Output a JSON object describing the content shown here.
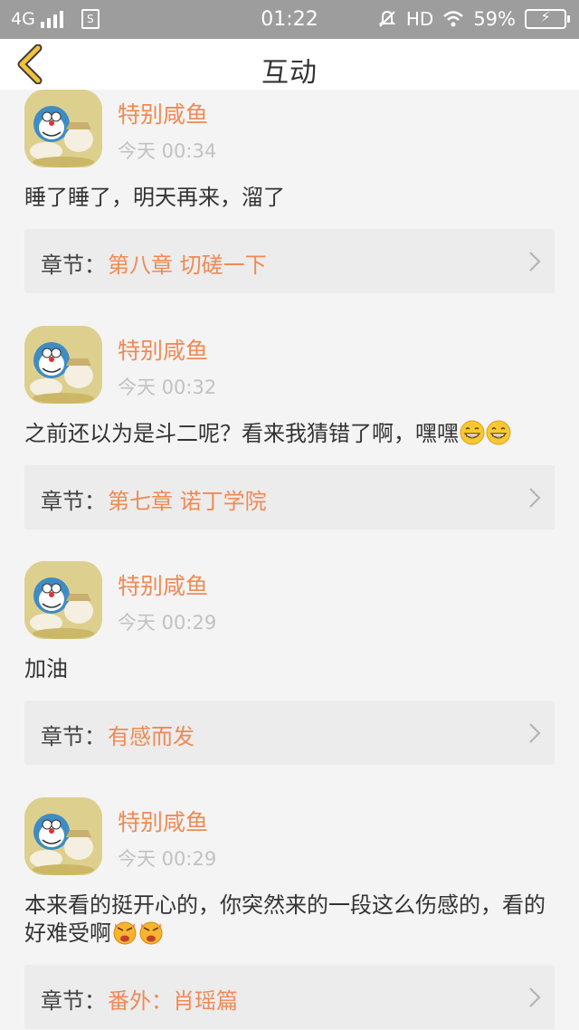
{
  "status_bar": {
    "network": "4G",
    "time": "01:22",
    "hd": "HD",
    "battery": "59%"
  },
  "header": {
    "title": "互动",
    "back_icon": "chevron-left-icon"
  },
  "colors": {
    "accent": "#ef8a55",
    "back_icon": "#f2c23a",
    "card_bg": "#ececec"
  },
  "comments": [
    {
      "username": "特别咸鱼",
      "time": "今天 00:34",
      "text": "睡了睡了，明天再来，溜了",
      "chapter_label": "章节：",
      "chapter": "第八章 切磋一下"
    },
    {
      "username": "特别咸鱼",
      "time": "今天 00:32",
      "text": "之前还以为是斗二呢？看来我猜错了啊，嘿嘿",
      "emoji": [
        "grin-emoji",
        "grin-emoji"
      ],
      "chapter_label": "章节：",
      "chapter": "第七章 诺丁学院"
    },
    {
      "username": "特别咸鱼",
      "time": "今天 00:29",
      "text": "加油",
      "chapter_label": "章节：",
      "chapter": "有感而发"
    },
    {
      "username": "特别咸鱼",
      "time": "今天 00:29",
      "text": "本来看的挺开心的，你突然来的一段这么伤感的，看的好难受啊",
      "emoji": [
        "crying-emoji",
        "crying-emoji"
      ],
      "chapter_label": "章节：",
      "chapter": "番外：肖瑶篇"
    }
  ]
}
